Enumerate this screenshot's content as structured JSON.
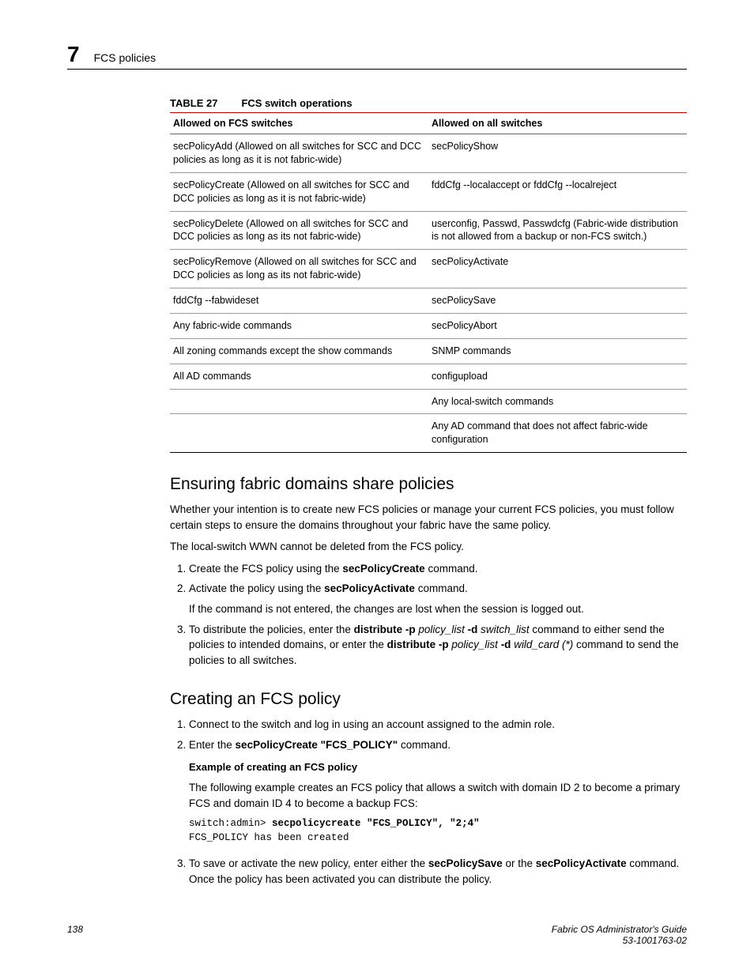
{
  "header": {
    "chapter_number": "7",
    "title": "FCS policies"
  },
  "table27": {
    "label": "TABLE 27",
    "caption": "FCS switch operations",
    "col1": "Allowed on FCS switches",
    "col2": "Allowed on all switches",
    "rows": [
      {
        "a": "secPolicyAdd (Allowed on all switches for SCC and DCC policies as long as it is not fabric-wide)",
        "b": "secPolicyShow"
      },
      {
        "a": "secPolicyCreate (Allowed on all switches for SCC and DCC policies as long as it is not fabric-wide)",
        "b": "fddCfg --localaccept or fddCfg --localreject"
      },
      {
        "a": "secPolicyDelete (Allowed on all switches for SCC and DCC policies as long as its not fabric-wide)",
        "b": "userconfig, Passwd, Passwdcfg (Fabric-wide distribution is not allowed from a backup or non-FCS switch.)"
      },
      {
        "a": "secPolicyRemove (Allowed on all switches for SCC and DCC policies as long as its not fabric-wide)",
        "b": "secPolicyActivate"
      },
      {
        "a": "fddCfg --fabwideset",
        "b": "secPolicySave"
      },
      {
        "a": "Any fabric-wide commands",
        "b": "secPolicyAbort"
      },
      {
        "a": "All zoning commands except the show commands",
        "b": "SNMP commands"
      },
      {
        "a": "All AD commands",
        "b": "configupload"
      },
      {
        "a": "",
        "b": "Any local-switch commands"
      },
      {
        "a": "",
        "b": "Any AD command that does not affect fabric-wide configuration"
      }
    ]
  },
  "section1": {
    "heading": "Ensuring fabric domains share policies",
    "p1": "Whether your intention is to create new FCS policies or manage your current FCS policies, you must follow certain steps to ensure the domains throughout your fabric have the same policy.",
    "p2": "The local-switch WWN cannot be deleted from the FCS policy.",
    "steps": {
      "s1_a": "Create the FCS policy using the ",
      "s1_b": "secPolicyCreate",
      "s1_c": " command.",
      "s2_a": "Activate the policy using the ",
      "s2_b": "secPolicyActivate",
      "s2_c": " command.",
      "s2_note": "If the command is not entered, the changes are lost when the session is logged out.",
      "s3_a": "To distribute the policies, enter the ",
      "s3_b": "distribute -p",
      "s3_c": " policy_list ",
      "s3_d": "-d",
      "s3_e": " switch_list",
      "s3_f": " command to either send the policies to intended domains, or enter the ",
      "s3_g": "distribute -p",
      "s3_h": " policy_list ",
      "s3_i": "-d",
      "s3_j": " wild_card (*)",
      "s3_k": " command to send the policies to all switches."
    }
  },
  "section2": {
    "heading": "Creating an FCS policy",
    "steps": {
      "s1": "Connect to the switch and log in using an account assigned to the admin role.",
      "s2_a": "Enter the ",
      "s2_b": "secPolicyCreate \"FCS_POLICY\"",
      "s2_c": " command.",
      "ex_title": "Example  of creating an FCS policy",
      "ex_p": "The following example creates an FCS policy that allows a switch with domain ID 2 to become a primary FCS and domain ID 4 to become a backup FCS:",
      "code_prompt": "switch:admin> ",
      "code_cmd": "secpolicycreate \"FCS_POLICY\", \"2;4\"",
      "code_out": "FCS_POLICY has been created",
      "s3_a": "To save or activate the new policy, enter either the ",
      "s3_b": "secPolicySave",
      "s3_c": " or the ",
      "s3_d": "secPolicyActivate",
      "s3_e": " command. Once the policy has been activated you can distribute the policy."
    }
  },
  "footer": {
    "page": "138",
    "guide": "Fabric OS Administrator's Guide",
    "docnum": "53-1001763-02"
  }
}
